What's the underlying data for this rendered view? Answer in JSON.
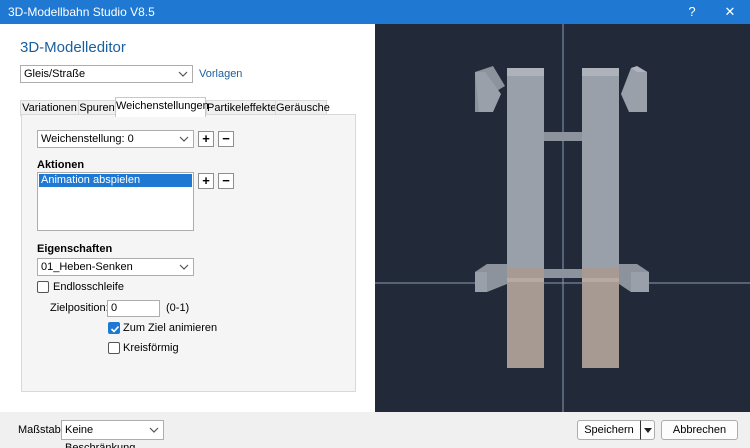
{
  "window": {
    "title": "3D-Modellbahn Studio V8.5",
    "help_glyph": "?",
    "close_glyph": "✕"
  },
  "editor": {
    "heading": "3D-Modelleditor",
    "category_value": "Gleis/Straße",
    "templates_link": "Vorlagen"
  },
  "tabs": [
    {
      "label": "Variationen"
    },
    {
      "label": "Spuren"
    },
    {
      "label": "Weichenstellungen",
      "active": true
    },
    {
      "label": "Partikeleffekte"
    },
    {
      "label": "Geräusche"
    }
  ],
  "panel": {
    "switch_setting_value": "Weichenstellung: 0",
    "plus": "+",
    "minus": "−",
    "actions_label": "Aktionen",
    "actions_items": [
      "Animation abspielen"
    ],
    "properties_label": "Eigenschaften",
    "property_value": "01_Heben-Senken",
    "loop_label": "Endlosschleife",
    "loop_checked": false,
    "target_label": "Zielposition:",
    "target_value": "0",
    "target_range": "(0-1)",
    "animate_label": "Zum Ziel animieren",
    "animate_checked": true,
    "circular_label": "Kreisförmig",
    "circular_checked": false
  },
  "viewport": {
    "background": "#222a3a",
    "model_color": "#9aa0aa",
    "legs_color": "#a79a92"
  },
  "footer": {
    "scale_label": "Maßstab:",
    "scale_value": "Keine Beschränkung",
    "save_label": "Speichern",
    "cancel_label": "Abbrechen"
  },
  "icons": {
    "chevron": "chevron-down-icon",
    "checkmark": "checkmark-icon"
  },
  "colors": {
    "accent": "#1f78d1",
    "heading": "#1a5f9e"
  }
}
